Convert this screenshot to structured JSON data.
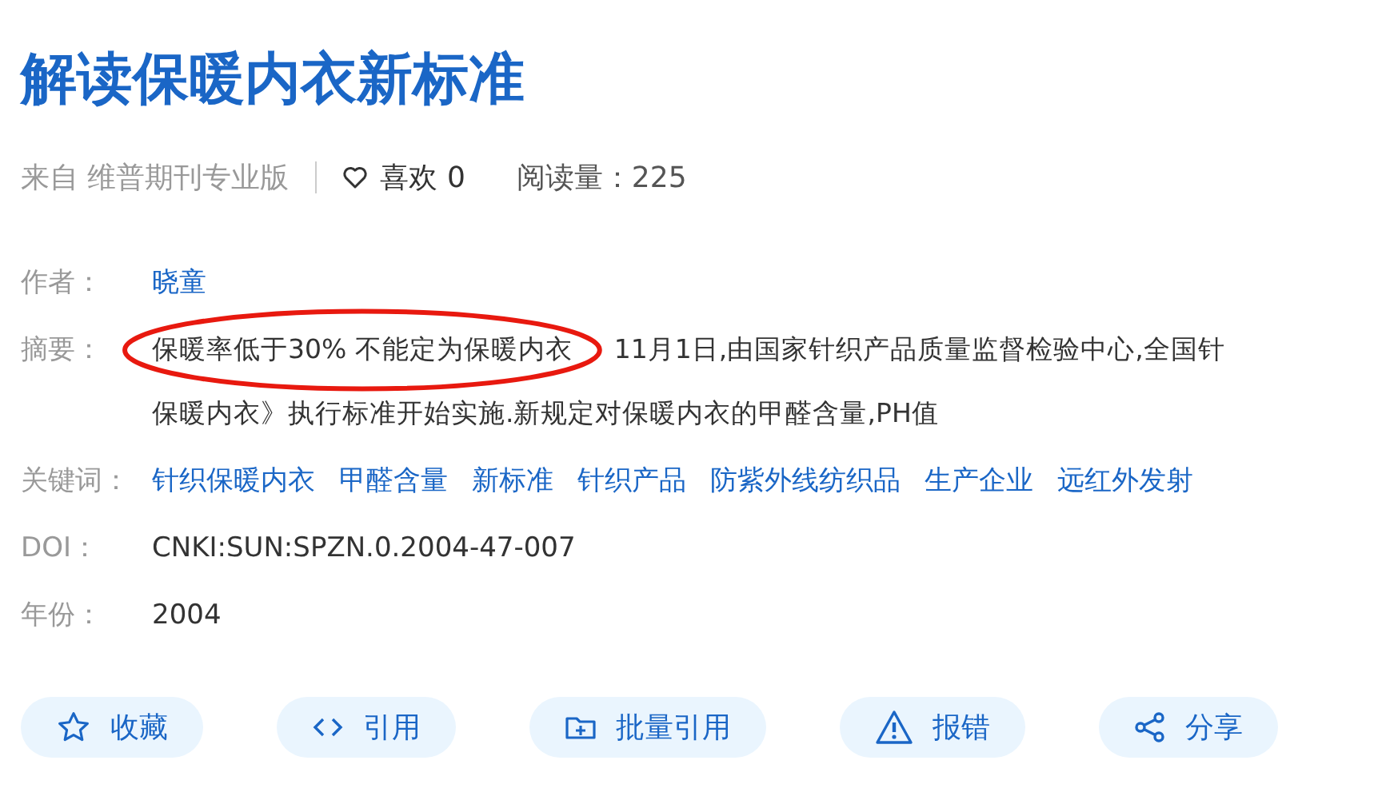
{
  "title": "解读保暖内衣新标准",
  "meta": {
    "source": "来自 维普期刊专业版",
    "likes": "喜欢 0",
    "reads": "阅读量：225"
  },
  "fields": [
    {
      "kind": "author",
      "label": "作者：",
      "value": "晓童"
    },
    {
      "kind": "abstract",
      "label": "摘要：",
      "highlighted": "保暖率低于30% 不能定为保暖内衣",
      "lines": [
        "11月1日,由国家针织产品质量监督检验中心,全国针",
        "保暖内衣》执行标准开始实施.新规定对保暖内衣的甲醛含量,PH值"
      ]
    },
    {
      "kind": "keywords",
      "label": "关键词：",
      "items": [
        "针织保暖内衣",
        "甲醛含量",
        "新标准",
        "针织产品",
        "防紫外线纺织品",
        "生产企业",
        "远红外发射"
      ]
    },
    {
      "kind": "text",
      "label": "DOI：",
      "value": "CNKI:SUN:SPZN.0.2004-47-007"
    },
    {
      "kind": "text",
      "label": "年份：",
      "value": "2004"
    }
  ],
  "actions": [
    {
      "kind": "star",
      "label": "收藏"
    },
    {
      "kind": "code",
      "label": "引用"
    },
    {
      "kind": "folder",
      "label": "批量引用"
    },
    {
      "kind": "warning",
      "label": "报错"
    },
    {
      "kind": "share",
      "label": "分享"
    }
  ]
}
